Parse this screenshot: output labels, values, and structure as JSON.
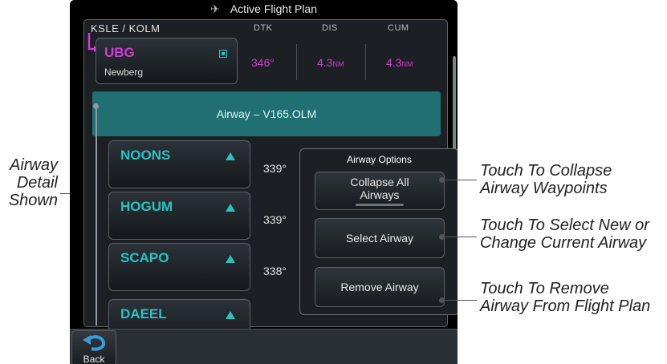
{
  "title_bar": {
    "title": "Active Flight Plan",
    "icon": "airplane-icon"
  },
  "list": {
    "route": "KSLE / KOLM",
    "columns": {
      "dtk": "DTK",
      "dis": "DIS",
      "cum": "CUM"
    },
    "active_leg": {
      "ident": "UBG",
      "name": "Newberg",
      "dtk": "346°",
      "dis": "4.3",
      "dis_unit": "NM",
      "cum": "4.3",
      "cum_unit": "NM"
    },
    "airway_bar": "Airway – V165.OLM",
    "waypoints": [
      {
        "ident": "NOONS",
        "dtk": "339°"
      },
      {
        "ident": "HOGUM",
        "dtk": "339°"
      },
      {
        "ident": "SCAPO",
        "dtk": "338°"
      },
      {
        "ident": "DAEEL",
        "dtk": ""
      }
    ]
  },
  "airway_options": {
    "title": "Airway Options",
    "collapse_label_1": "Collapse All",
    "collapse_label_2": "Airways",
    "select_label": "Select Airway",
    "remove_label": "Remove Airway"
  },
  "bottom": {
    "back_label": "Back"
  },
  "callouts": {
    "airway_detail_1": "Airway",
    "airway_detail_2": "Detail",
    "airway_detail_3": "Shown",
    "collapse_1": "Touch To Collapse",
    "collapse_2": "Airway Waypoints",
    "select_1": "Touch To Select New or",
    "select_2": "Change Current Airway",
    "remove_1": "Touch To Remove",
    "remove_2": "Airway From Flight Plan"
  },
  "colors": {
    "accent": "#27c3c3",
    "magenta": "#d13cd1",
    "airway_bar": "#1f6f73"
  }
}
